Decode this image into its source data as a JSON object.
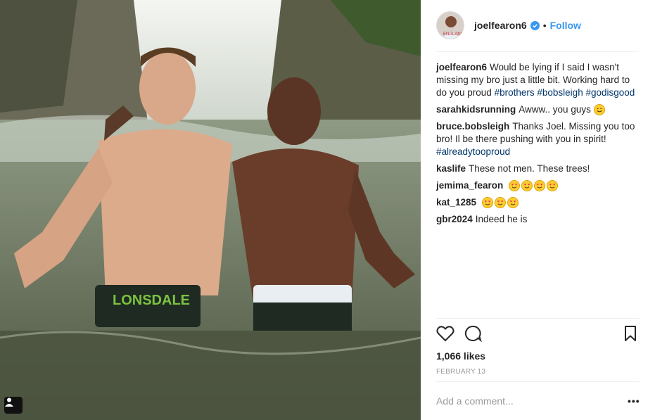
{
  "post": {
    "username": "joelfearon6",
    "follow_label": "Follow",
    "dot": "•",
    "caption": {
      "user": "joelfearon6",
      "text": "Would be lying if I said I wasn't missing my bro just a little bit. Working hard to do you proud",
      "tags": [
        "#brothers",
        "#bobsleigh",
        "#godisgood"
      ]
    },
    "likes": "1,066 likes",
    "date": "FEBRUARY 13",
    "add_comment_placeholder": "Add a comment...",
    "more": "•••",
    "photo_text": "LONSDALE",
    "avatar_text": "ENGLAND"
  },
  "comments": [
    {
      "user": "sarahkidsrunning",
      "text": "Awww.. you guys",
      "emoji": "smile",
      "emoji_count": 1
    },
    {
      "user": "bruce.bobsleigh",
      "text": "Thanks Joel. Missing you too bro! Il be there pushing with you in spirit!",
      "tag": "#alreadytooproud"
    },
    {
      "user": "kaslife",
      "text": "These not men. These trees!"
    },
    {
      "user": "jemima_fearon",
      "text": "",
      "emoji": "heart-eyes",
      "emoji_count": 4
    },
    {
      "user": "kat_1285",
      "text": "",
      "emoji": "heart-eyes",
      "emoji_count": 3
    },
    {
      "user": "gbr2024",
      "text": "Indeed he is"
    }
  ],
  "icons": {
    "like": "heart-icon",
    "comment": "comment-bubble-icon",
    "save": "bookmark-icon",
    "verified": "verified-badge-icon",
    "tagged": "user-tag-icon"
  },
  "colors": {
    "link": "#3897f0",
    "hashtag": "#003569",
    "muted": "#999999"
  }
}
